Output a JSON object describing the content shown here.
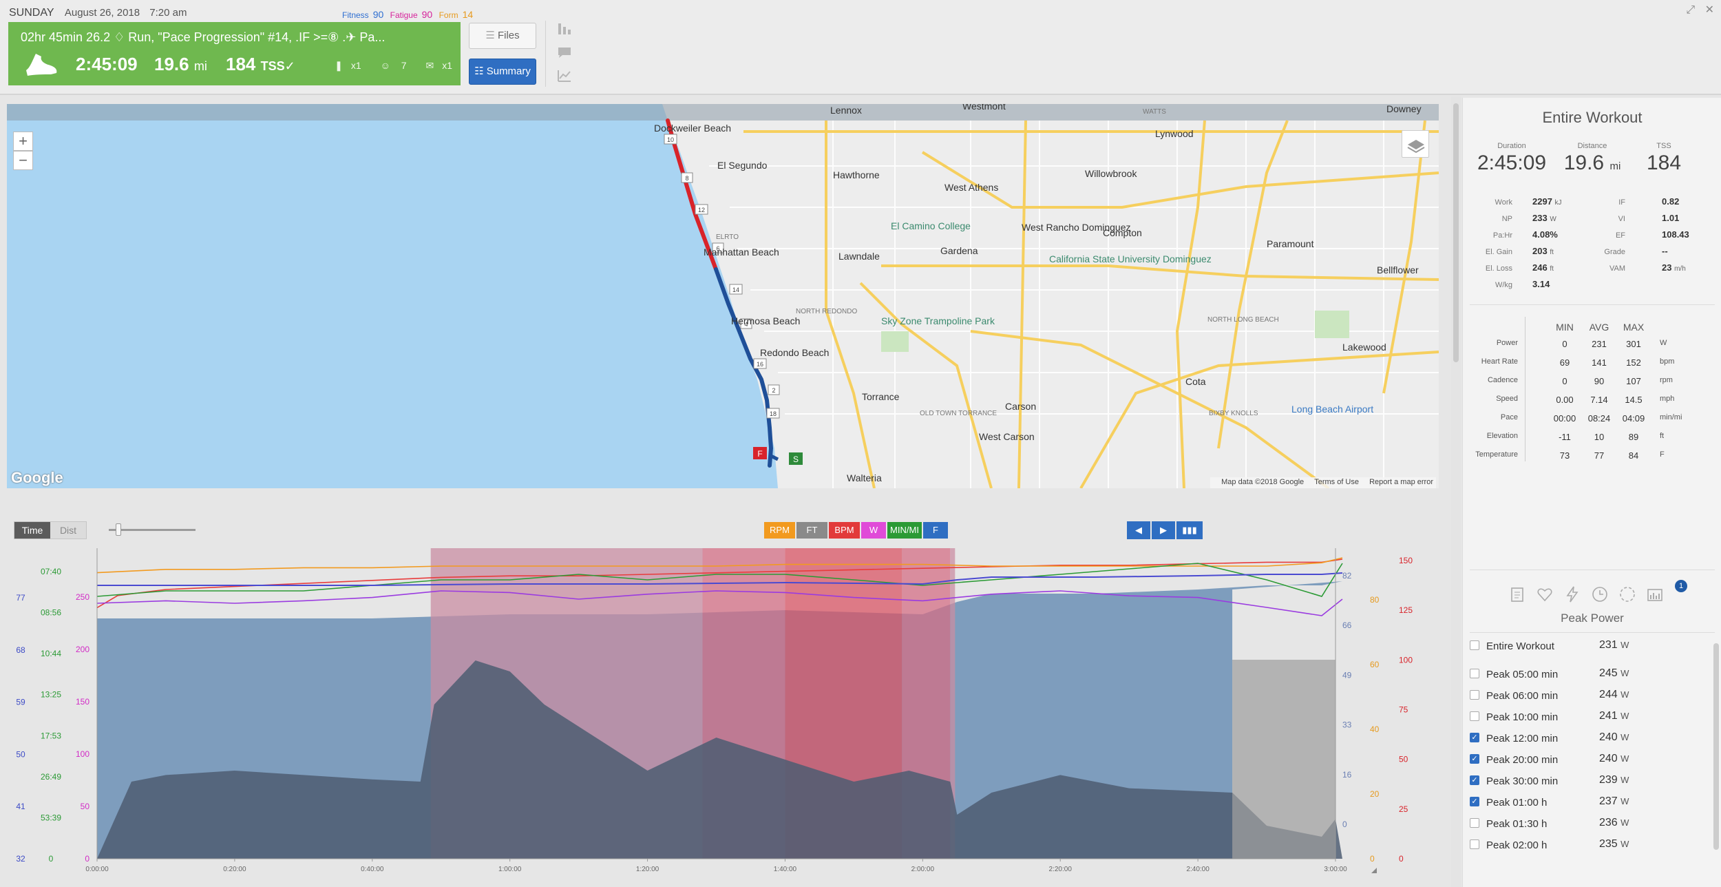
{
  "header": {
    "day": "SUNDAY",
    "date": "August 26, 2018",
    "time": "7:20 am",
    "fitness_label": "Fitness",
    "fitness_value": "90",
    "fatigue_label": "Fatigue",
    "fatigue_value": "90",
    "form_label": "Form",
    "form_value": "14"
  },
  "workout": {
    "title": "02hr 45min 26.2 ♢ Run, \"Pace Progression\" #14, .IF >=⑧ .✈ Pa...",
    "duration": "2:45:09",
    "distance": "19.6",
    "distance_unit": "mi",
    "tss": "184",
    "tss_unit": "TSS",
    "equipment_count": "x1",
    "rating": "7",
    "comments_count": "x1",
    "color": "#6fb84f"
  },
  "buttons": {
    "files": "Files",
    "summary": "Summary"
  },
  "map": {
    "attribution": "Map data ©2018 Google",
    "terms": "Terms of Use",
    "report": "Report a map error",
    "logo": "Google",
    "place_labels": [
      "Lennox",
      "Westmont",
      "WATTS",
      "Downey",
      "Dockweiler Beach",
      "El Segundo",
      "Hawthorne",
      "West Athens",
      "Willowbrook",
      "Lynwood",
      "El Camino College",
      "Gardena",
      "West Rancho Dominguez",
      "Compton",
      "Paramount",
      "Bellflower",
      "Manhattan Beach",
      "Lawndale",
      "California State University Dominguez",
      "Hermosa Beach",
      "NORTH REDONDO",
      "Sky Zone Trampoline Park",
      "NORTH LONG BEACH",
      "Lakewood",
      "Redondo Beach",
      "Torrance",
      "Carson",
      "Cota",
      "Long Beach Airport",
      "OLD TOWN TORRANCE",
      "BIXBY KNOLLS",
      "West Carson",
      "Walteria",
      "ELRTO"
    ],
    "start_marker": "S",
    "finish_marker": "F",
    "mile_markers": [
      "10",
      "8",
      "12",
      "6",
      "14",
      "4",
      "16",
      "2",
      "18"
    ]
  },
  "chart_controls": {
    "time": "Time",
    "dist": "Dist",
    "toggles": [
      {
        "label": "RPM",
        "color": "#f29a1f"
      },
      {
        "label": "FT",
        "color": "#8a8a8a"
      },
      {
        "label": "BPM",
        "color": "#e23a3a"
      },
      {
        "label": "W",
        "color": "#e04bd8"
      },
      {
        "label": "MIN/MI",
        "color": "#2b9a35"
      },
      {
        "label": "F",
        "color": "#2f6ec2"
      }
    ]
  },
  "chart_data": {
    "type": "line",
    "x_ticks": [
      "0:00:00",
      "0:20:00",
      "0:40:00",
      "1:00:00",
      "1:20:00",
      "1:40:00",
      "2:00:00",
      "2:20:00",
      "2:40:00",
      "3:00:00"
    ],
    "axes": {
      "blue_left": [
        "77",
        "68",
        "59",
        "50",
        "41",
        "32"
      ],
      "pace_left": [
        "07:40",
        "08:56",
        "10:44",
        "13:25",
        "17:53",
        "26:49",
        "53:39",
        "0"
      ],
      "power_left": [
        "250",
        "200",
        "150",
        "100",
        "50",
        "0"
      ],
      "blue_right": [
        "82",
        "66",
        "49",
        "33",
        "16",
        "0"
      ],
      "cadence_right": [
        "80",
        "60",
        "40",
        "20",
        "0"
      ],
      "hr_right": [
        "150",
        "125",
        "100",
        "75",
        "50",
        "25",
        "0"
      ]
    },
    "zones": [
      {
        "start_min": 48.5,
        "end_min": 88,
        "color": "#c98ea3"
      },
      {
        "start_min": 88,
        "end_min": 100,
        "color": "#d46f85"
      },
      {
        "start_min": 100,
        "end_min": 117,
        "color": "#d95566"
      },
      {
        "start_min": 117,
        "end_min": 124,
        "color": "#d46f85"
      },
      {
        "start_min": 124,
        "end_min": 124.7,
        "color": "#c98ea3"
      }
    ],
    "series": [
      {
        "name": "Elevation",
        "color": "#5b6e86",
        "x": [
          0,
          5,
          10,
          20,
          30,
          40,
          47,
          49,
          55,
          60,
          65,
          70,
          80,
          90,
          100,
          110,
          118,
          124,
          125,
          130,
          140,
          150,
          165,
          170,
          178,
          180,
          181
        ],
        "y": [
          0,
          35,
          38,
          40,
          38,
          36,
          35,
          70,
          90,
          85,
          70,
          60,
          40,
          55,
          45,
          35,
          40,
          35,
          20,
          30,
          38,
          32,
          30,
          15,
          10,
          18,
          0
        ]
      },
      {
        "name": "Heart Rate",
        "color": "#e83c3c",
        "x": [
          0,
          3,
          10,
          20,
          30,
          40,
          50,
          60,
          70,
          80,
          90,
          100,
          110,
          120,
          130,
          140,
          150,
          160,
          170,
          178,
          181
        ],
        "y": [
          120,
          128,
          132,
          134,
          136,
          138,
          140,
          141,
          141,
          142,
          143,
          144,
          145,
          146,
          147,
          148,
          148,
          149,
          150,
          150,
          152
        ]
      },
      {
        "name": "Cadence",
        "color": "#f29a1f",
        "x": [
          0,
          10,
          20,
          30,
          40,
          50,
          60,
          70,
          80,
          90,
          100,
          110,
          120,
          130,
          140,
          150,
          160,
          170,
          178,
          181
        ],
        "y": [
          86,
          88,
          88,
          89,
          89,
          90,
          90,
          90,
          90,
          90,
          91,
          91,
          91,
          90,
          90,
          90,
          90,
          90,
          92,
          95
        ]
      },
      {
        "name": "Power",
        "color": "#9a3be0",
        "x": [
          0,
          10,
          20,
          30,
          40,
          50,
          60,
          70,
          80,
          90,
          100,
          110,
          120,
          130,
          140,
          150,
          160,
          170,
          178,
          181
        ],
        "y": [
          225,
          228,
          225,
          228,
          232,
          240,
          238,
          230,
          236,
          240,
          238,
          232,
          228,
          236,
          240,
          234,
          232,
          220,
          210,
          230
        ]
      },
      {
        "name": "Pace",
        "color": "#2b9a35",
        "x": [
          0,
          10,
          20,
          30,
          40,
          50,
          60,
          70,
          80,
          90,
          100,
          110,
          120,
          130,
          140,
          150,
          160,
          170,
          178,
          181
        ],
        "y": [
          8.6,
          8.5,
          8.5,
          8.5,
          8.4,
          8.3,
          8.3,
          8.2,
          8.3,
          8.2,
          8.2,
          8.3,
          8.4,
          8.3,
          8.2,
          8.1,
          8.0,
          8.3,
          8.6,
          8.0
        ]
      },
      {
        "name": "Speed",
        "color": "#4a4ad1",
        "x": [
          0,
          10,
          20,
          40,
          60,
          80,
          100,
          120,
          125,
          130,
          145,
          160,
          170,
          178,
          181
        ],
        "y": [
          72,
          72,
          72,
          72,
          73,
          73,
          74,
          73,
          76,
          78,
          78,
          79,
          80,
          80,
          81
        ]
      }
    ]
  },
  "summary": {
    "title": "Entire Workout",
    "duration_label": "Duration",
    "duration": "2:45:09",
    "distance_label": "Distance",
    "distance": "19.6",
    "distance_unit": "mi",
    "tss_label": "TSS",
    "tss": "184",
    "work_label": "Work",
    "work": "2297",
    "work_unit": "kJ",
    "np_label": "NP",
    "np": "233",
    "np_unit": "W",
    "pahr_label": "Pa:Hr",
    "pahr": "4.08%",
    "elgain_label": "El. Gain",
    "elgain": "203",
    "elgain_unit": "ft",
    "elloss_label": "El. Loss",
    "elloss": "246",
    "elloss_unit": "ft",
    "wkg_label": "W/kg",
    "wkg": "3.14",
    "if_label": "IF",
    "if": "0.82",
    "vi_label": "VI",
    "vi": "1.01",
    "ef_label": "EF",
    "ef": "108.43",
    "grade_label": "Grade",
    "grade": "--",
    "vam_label": "VAM",
    "vam": "23",
    "vam_unit": "m/h"
  },
  "minmax": {
    "headers": [
      "MIN",
      "AVG",
      "MAX"
    ],
    "rows": [
      {
        "label": "Power",
        "min": "0",
        "avg": "231",
        "max": "301",
        "unit": "W"
      },
      {
        "label": "Heart Rate",
        "min": "69",
        "avg": "141",
        "max": "152",
        "unit": "bpm"
      },
      {
        "label": "Cadence",
        "min": "0",
        "avg": "90",
        "max": "107",
        "unit": "rpm"
      },
      {
        "label": "Speed",
        "min": "0.00",
        "avg": "7.14",
        "max": "14.5",
        "unit": "mph"
      },
      {
        "label": "Pace",
        "min": "00:00",
        "avg": "08:24",
        "max": "04:09",
        "unit": "min/mi"
      },
      {
        "label": "Elevation",
        "min": "-11",
        "avg": "10",
        "max": "89",
        "unit": "ft"
      },
      {
        "label": "Temperature",
        "min": "73",
        "avg": "77",
        "max": "84",
        "unit": "F"
      }
    ]
  },
  "peaks": {
    "title": "Peak Power",
    "badge": "1",
    "rows": [
      {
        "label": "Entire Workout",
        "value": "231",
        "unit": "W",
        "checked": false
      },
      {
        "label": "Peak 05:00 min",
        "value": "245",
        "unit": "W",
        "checked": false
      },
      {
        "label": "Peak 06:00 min",
        "value": "244",
        "unit": "W",
        "checked": false
      },
      {
        "label": "Peak 10:00 min",
        "value": "241",
        "unit": "W",
        "checked": false
      },
      {
        "label": "Peak 12:00 min",
        "value": "240",
        "unit": "W",
        "checked": true
      },
      {
        "label": "Peak 20:00 min",
        "value": "240",
        "unit": "W",
        "checked": true
      },
      {
        "label": "Peak 30:00 min",
        "value": "239",
        "unit": "W",
        "checked": true
      },
      {
        "label": "Peak 01:00 h",
        "value": "237",
        "unit": "W",
        "checked": true
      },
      {
        "label": "Peak 01:30 h",
        "value": "236",
        "unit": "W",
        "checked": false
      },
      {
        "label": "Peak 02:00 h",
        "value": "235",
        "unit": "W",
        "checked": false
      }
    ]
  }
}
